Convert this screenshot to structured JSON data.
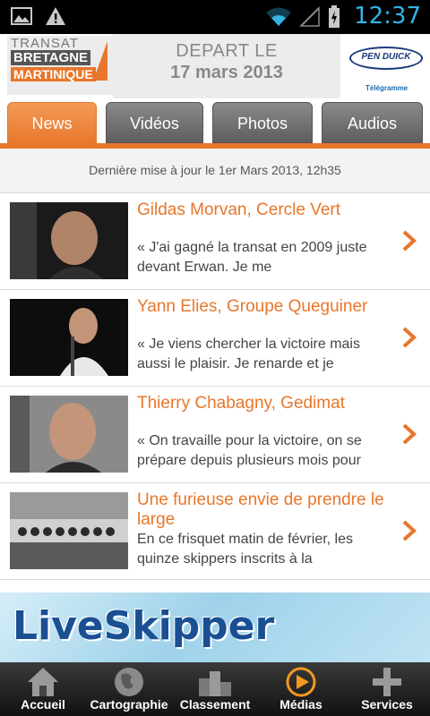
{
  "status_bar": {
    "time": "12:37",
    "icons": [
      "image-icon",
      "warning-icon",
      "wifi-icon",
      "signal-icon",
      "battery-icon"
    ]
  },
  "banner": {
    "logo_line1": "TRANSAT",
    "logo_line2": "BRETAGNE",
    "logo_line3": "MARTINIQUE",
    "depart_line1": "DEPART LE",
    "depart_line2": "17 mars 2013",
    "sponsor_name": "PEN DUICK",
    "sponsor_sub": "Télégramme"
  },
  "tabs": [
    {
      "label": "News",
      "active": true
    },
    {
      "label": "Vidéos",
      "active": false
    },
    {
      "label": "Photos",
      "active": false
    },
    {
      "label": "Audios",
      "active": false
    }
  ],
  "update_text": "Dernière mise à jour le 1er Mars 2013, 12h35",
  "news": [
    {
      "title": "Gildas Morvan, Cercle Vert",
      "excerpt": "« J'ai gagné la transat en 2009 juste devant Erwan. Je me"
    },
    {
      "title": "Yann Elies, Groupe Queguiner",
      "excerpt": "« Je viens chercher la victoire mais aussi le plaisir. Je renarde et je"
    },
    {
      "title": "Thierry Chabagny, Gedimat",
      "excerpt": "« On travaille pour la victoire, on se prépare depuis plusieurs mois pour"
    },
    {
      "title": "Une furieuse envie de prendre le large",
      "excerpt": "En ce frisquet matin de février, les quinze skippers inscrits à la"
    }
  ],
  "live_banner": "LiveSkipper",
  "bottom_nav": [
    {
      "label": "Accueil",
      "icon": "home-icon"
    },
    {
      "label": "Cartographie",
      "icon": "globe-icon"
    },
    {
      "label": "Classement",
      "icon": "podium-icon"
    },
    {
      "label": "Médias",
      "icon": "play-icon"
    },
    {
      "label": "Services",
      "icon": "plus-icon"
    }
  ],
  "colors": {
    "accent": "#e8762b",
    "status_blue": "#33b5e5",
    "brand_blue": "#1b4f93"
  }
}
